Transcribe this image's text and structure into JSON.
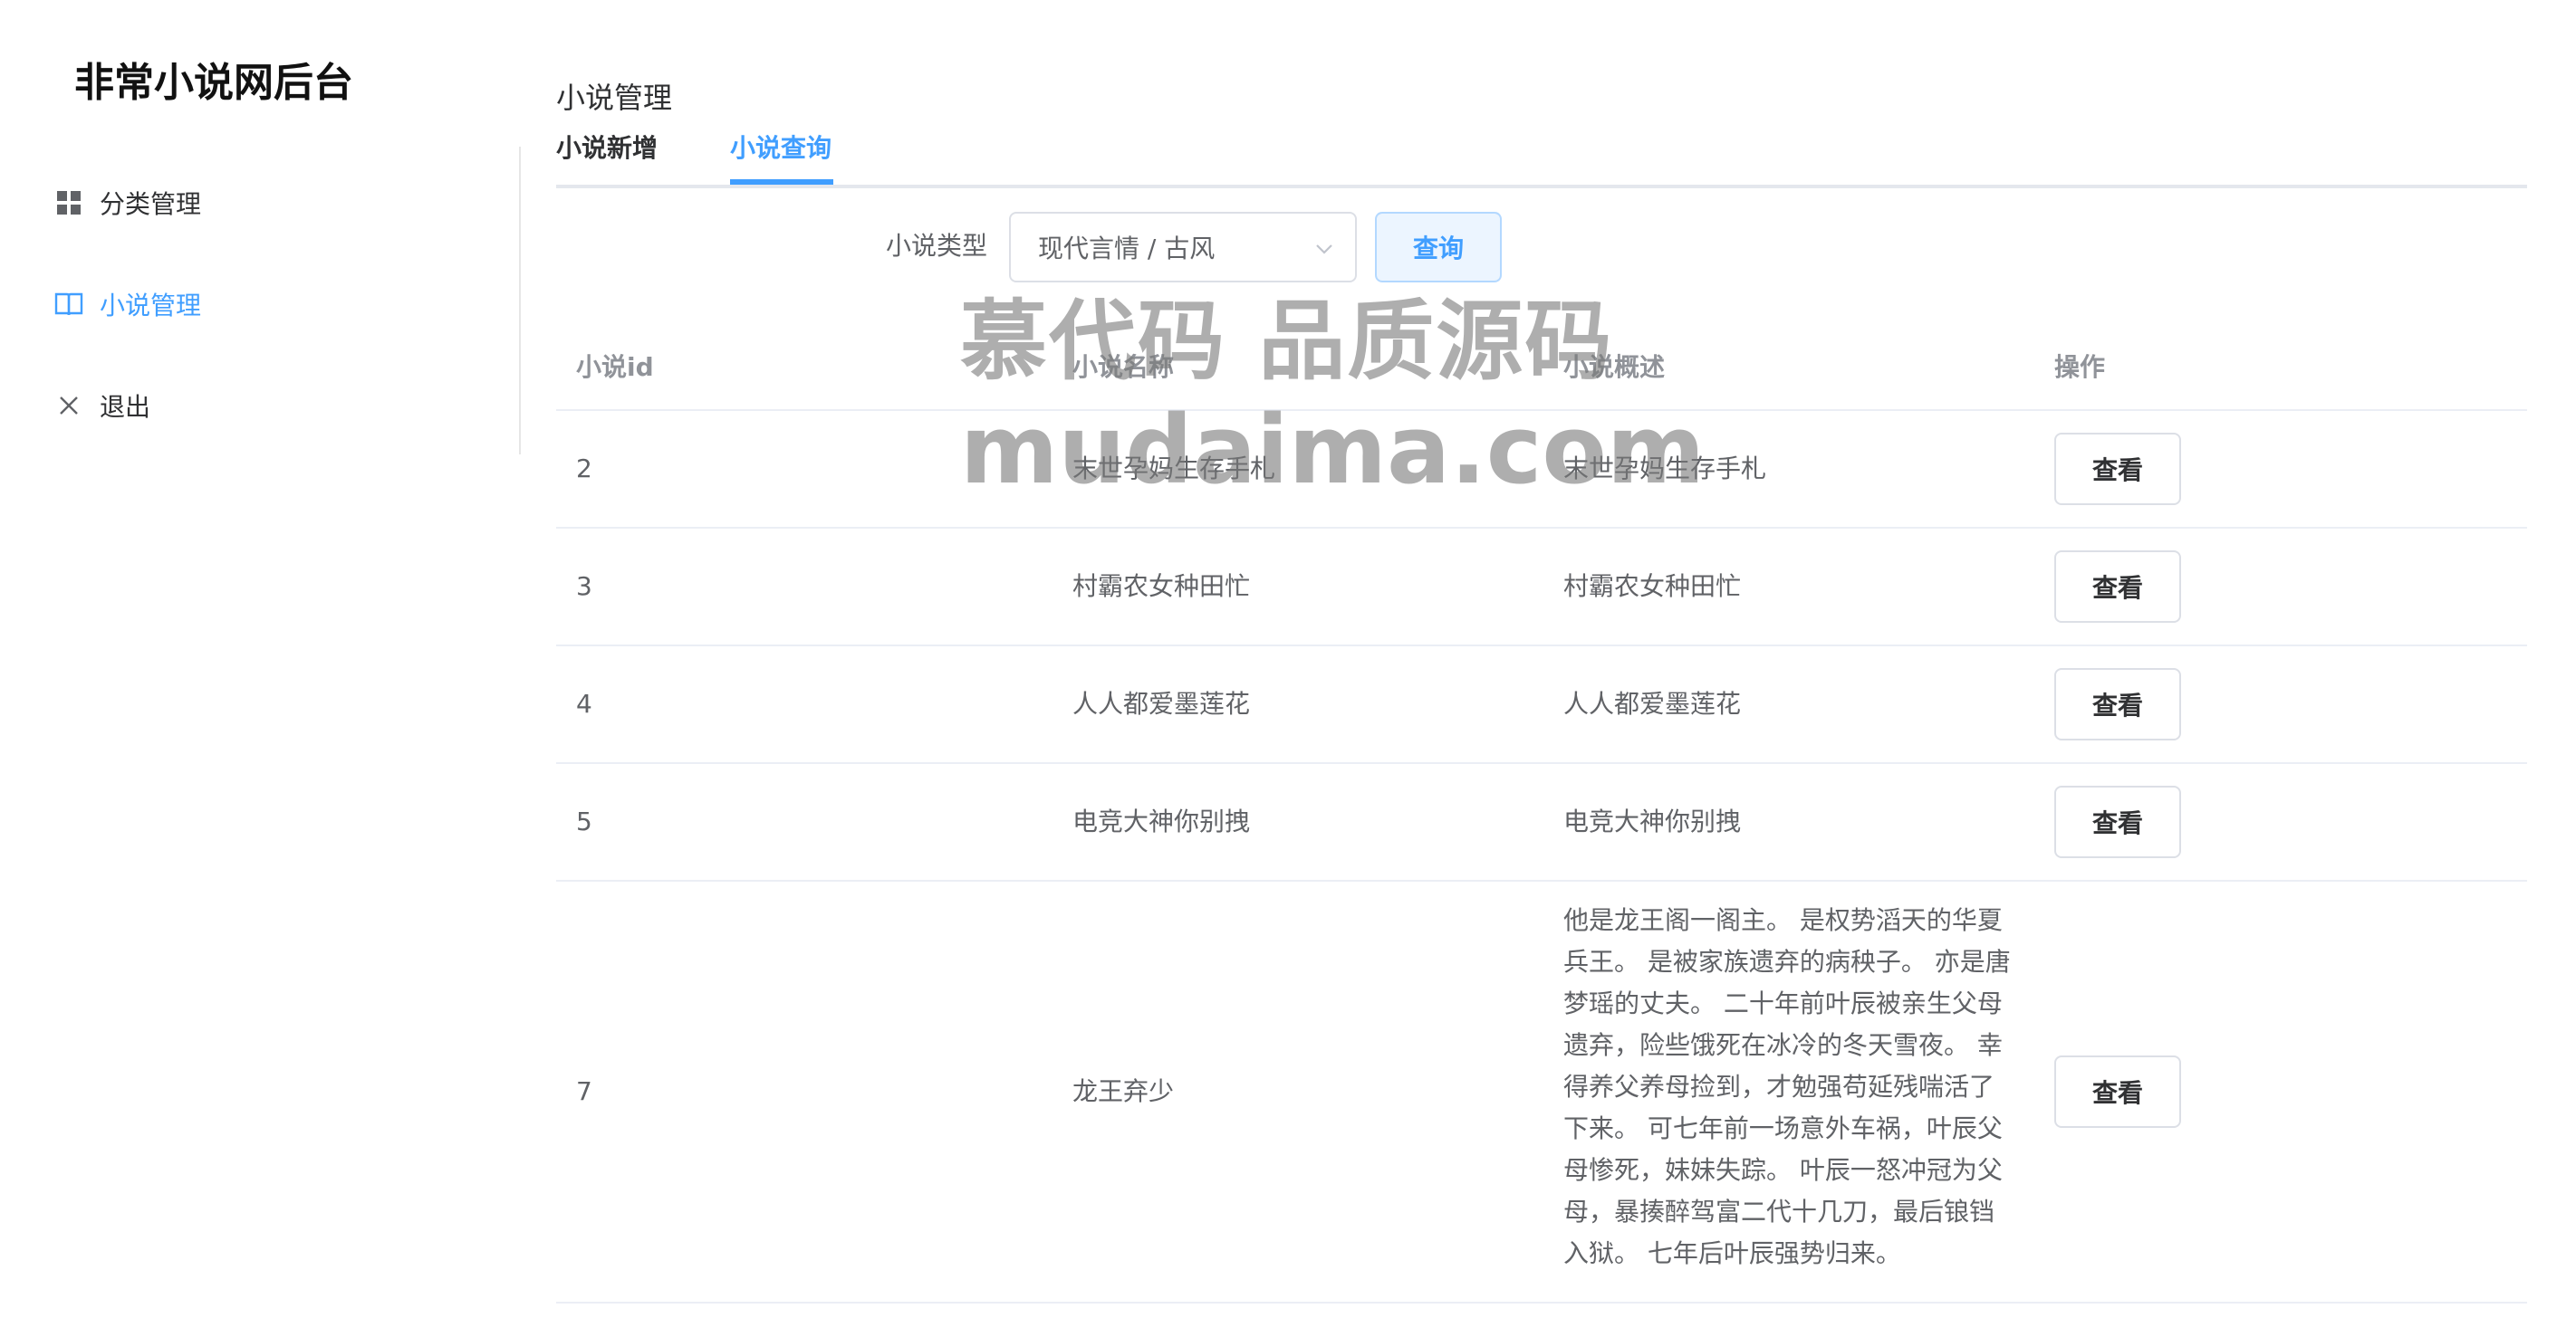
{
  "app": {
    "title": "非常小说网后台"
  },
  "sidebar": {
    "items": [
      {
        "label": "分类管理",
        "icon": "grid-icon",
        "active": false
      },
      {
        "label": "小说管理",
        "icon": "book-icon",
        "active": true
      },
      {
        "label": "退出",
        "icon": "close-icon",
        "active": false
      }
    ]
  },
  "main": {
    "breadcrumb": "小说管理",
    "tabs": [
      {
        "label": "小说新增",
        "active": false
      },
      {
        "label": "小说查询",
        "active": true
      }
    ],
    "filter": {
      "label": "小说类型",
      "selected": "现代言情 / 古风",
      "query_button": "查询"
    },
    "table": {
      "headers": [
        "小说id",
        "小说名称",
        "小说概述",
        "操作"
      ],
      "rows": [
        {
          "id": "2",
          "name": "末世孕妈生存手札",
          "desc": "末世孕妈生存手札",
          "action": "查看"
        },
        {
          "id": "3",
          "name": "村霸农女种田忙",
          "desc": "村霸农女种田忙",
          "action": "查看"
        },
        {
          "id": "4",
          "name": "人人都爱墨莲花",
          "desc": "人人都爱墨莲花",
          "action": "查看"
        },
        {
          "id": "5",
          "name": "电竞大神你别拽",
          "desc": "电竞大神你别拽",
          "action": "查看"
        },
        {
          "id": "7",
          "name": "龙王弃少",
          "desc": "他是龙王阁一阁主。 是权势滔天的华夏兵王。 是被家族遗弃的病秧子。 亦是唐梦瑶的丈夫。 二十年前叶辰被亲生父母遗弃，险些饿死在冰冷的冬天雪夜。 幸得养父养母捡到，才勉强苟延残喘活了下来。 可七年前一场意外车祸，叶辰父母惨死，妹妹失踪。 叶辰一怒冲冠为父母，暴揍醉驾富二代十几刀，最后锒铛入狱。 七年后叶辰强势归来。",
          "action": "查看"
        }
      ]
    }
  },
  "watermark": {
    "line1": "慕代码 品质源码",
    "line2": "mudaima.com"
  },
  "colors": {
    "accent": "#409eff",
    "border": "#dcdfe6",
    "header_text": "#909399"
  }
}
